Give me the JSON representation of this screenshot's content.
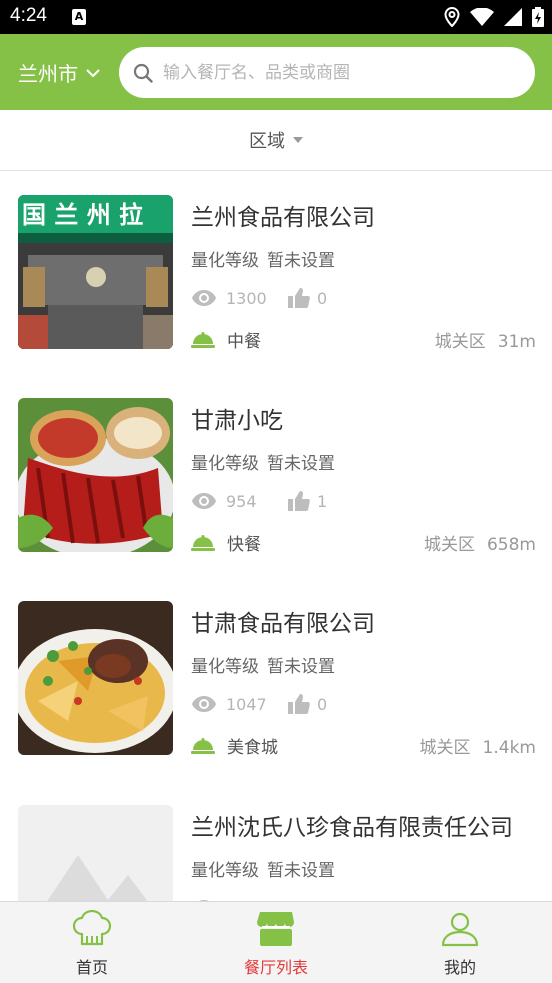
{
  "status_bar": {
    "time": "4:24",
    "notification_glyph": "A"
  },
  "header": {
    "city": "兰州市",
    "search_placeholder": "输入餐厅名、品类或商圈"
  },
  "filter": {
    "area_label": "区域"
  },
  "restaurants": [
    {
      "name": "兰州食品有限公司",
      "level_label": "量化等级",
      "level_value": "暂未设置",
      "views": "1300",
      "likes": "0",
      "category": "中餐",
      "district": "城关区",
      "distance": "31m"
    },
    {
      "name": "甘肃小吃",
      "level_label": "量化等级",
      "level_value": "暂未设置",
      "views": "954",
      "likes": "1",
      "category": "快餐",
      "district": "城关区",
      "distance": "658m"
    },
    {
      "name": "甘肃食品有限公司",
      "level_label": "量化等级",
      "level_value": "暂未设置",
      "views": "1047",
      "likes": "0",
      "category": "美食城",
      "district": "城关区",
      "distance": "1.4km"
    },
    {
      "name": "兰州沈氏八珍食品有限责任公司",
      "level_label": "量化等级",
      "level_value": "暂未设置",
      "views": "",
      "likes": "",
      "category": "",
      "district": "",
      "distance": ""
    }
  ],
  "tabs": [
    {
      "label": "首页",
      "icon": "chef-hat-icon"
    },
    {
      "label": "餐厅列表",
      "icon": "restaurant-store-icon"
    },
    {
      "label": "我的",
      "icon": "person-icon"
    }
  ],
  "colors": {
    "brand_green": "#86c147",
    "active_red": "#e23a3a",
    "muted_gray": "#b5b5b5"
  }
}
